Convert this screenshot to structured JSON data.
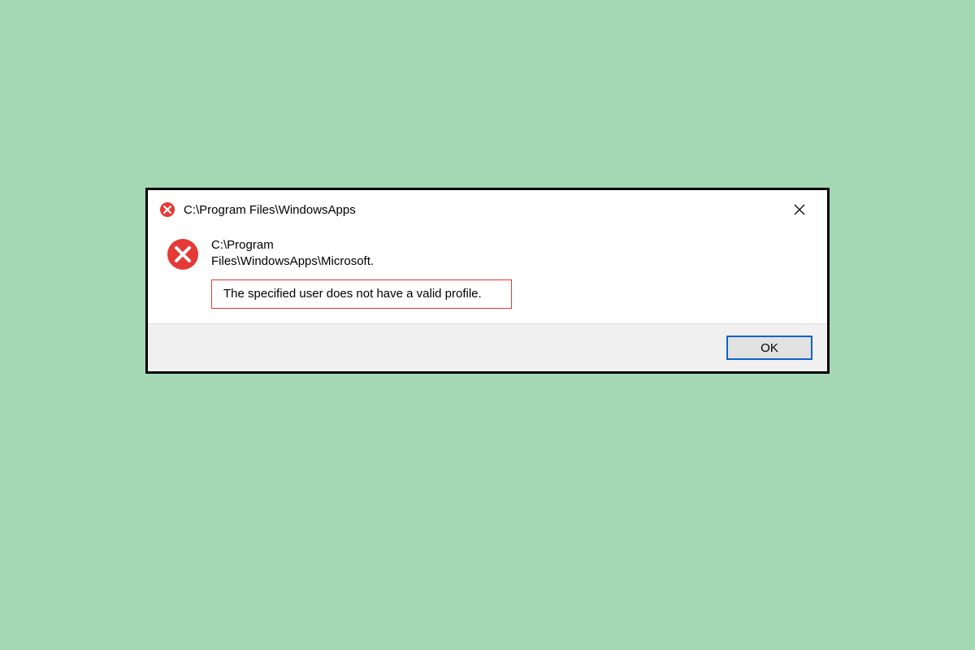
{
  "dialog": {
    "title": "C:\\Program Files\\WindowsApps",
    "path_line1": "C:\\Program",
    "path_line2": "Files\\WindowsApps\\Microsoft.",
    "error_message": "The specified user does not have a valid profile.",
    "ok_label": "OK"
  },
  "colors": {
    "error_red": "#e53935",
    "focus_blue": "#0a64c8"
  }
}
